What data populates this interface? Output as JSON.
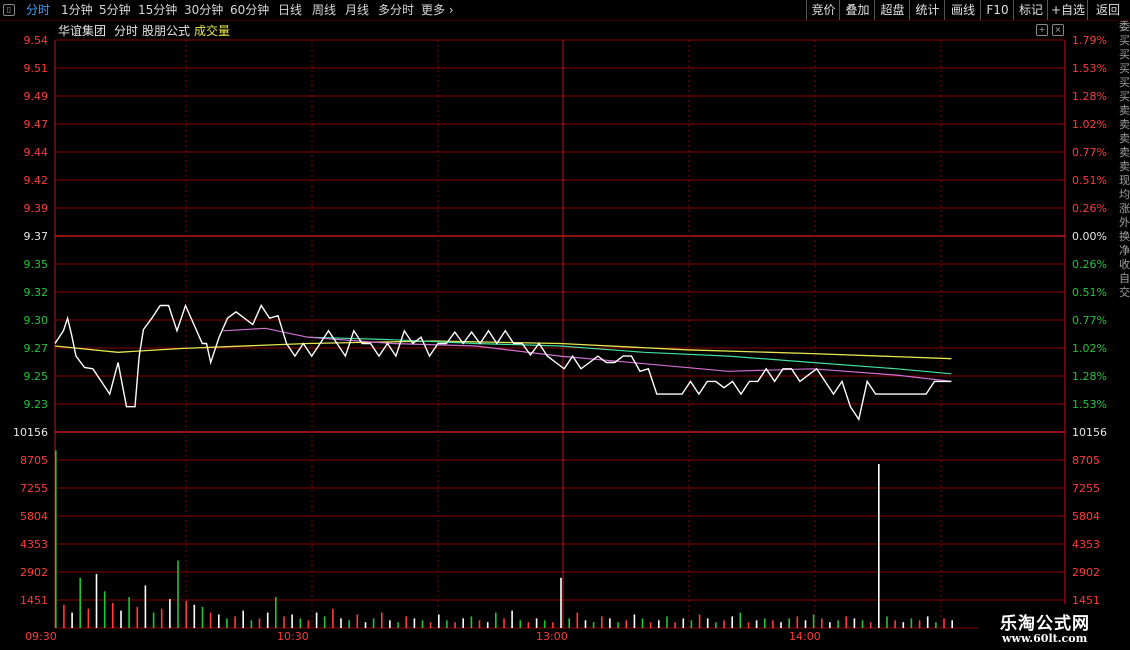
{
  "toolbar": {
    "left_tabs": [
      "分时",
      "1分钟",
      "5分钟",
      "15分钟",
      "30分钟",
      "60分钟",
      "日线",
      "周线",
      "月线",
      "多分时",
      "更多"
    ],
    "active_tab": "分时",
    "right_buttons": [
      "竞价",
      "叠加",
      "超盘",
      "统计",
      "画线",
      "F10",
      "标记",
      "+自选",
      "返回"
    ]
  },
  "header": {
    "stock_name": "华谊集团",
    "mode": "分时",
    "formula": "股朋公式",
    "volume_label": "成交量"
  },
  "price_axis": {
    "labels": [
      "9.54",
      "9.51",
      "9.49",
      "9.47",
      "9.44",
      "9.42",
      "9.39",
      "9.37",
      "9.35",
      "9.32",
      "9.30",
      "9.27",
      "9.25",
      "9.23"
    ],
    "pct_labels": [
      "1.79%",
      "1.53%",
      "1.28%",
      "1.02%",
      "0.77%",
      "0.51%",
      "0.26%",
      "0.00%",
      "0.26%",
      "0.51%",
      "0.77%",
      "1.02%",
      "1.28%",
      "1.53%"
    ],
    "prev_close": "9.37"
  },
  "volume_axis": {
    "labels": [
      "10156",
      "8705",
      "7255",
      "5804",
      "4353",
      "2902",
      "1451"
    ]
  },
  "time_axis": {
    "labels": [
      "09:30",
      "10:30",
      "13:00",
      "14:00"
    ]
  },
  "chart_data": {
    "type": "line",
    "x_unit": "minutes since 09:30 (0-240)",
    "price_series": {
      "name": "price",
      "x": [
        0,
        2,
        3,
        4,
        5,
        7,
        9,
        11,
        13,
        15,
        17,
        19,
        20,
        21,
        23,
        25,
        27,
        29,
        31,
        33,
        35,
        36,
        37,
        39,
        41,
        43,
        45,
        47,
        49,
        51,
        53,
        55,
        57,
        59,
        61,
        63,
        65,
        67,
        69,
        71,
        73,
        75,
        77,
        79,
        81,
        83,
        85,
        87,
        89,
        91,
        93,
        95,
        97,
        99,
        101,
        103,
        105,
        107,
        109,
        111,
        113,
        115,
        117,
        119,
        121,
        123,
        125,
        127,
        129,
        131,
        133,
        135,
        137,
        139,
        141,
        143,
        145,
        147,
        149,
        151,
        153,
        155,
        157,
        159,
        161,
        163,
        165,
        167,
        169,
        171,
        173,
        175,
        177,
        179,
        181,
        183,
        185,
        187,
        189,
        191,
        193,
        195,
        197,
        199,
        201,
        203,
        205,
        207,
        209,
        211,
        213
      ],
      "values": [
        9.3,
        9.31,
        9.32,
        9.306,
        9.29,
        9.281,
        9.28,
        9.27,
        9.26,
        9.285,
        9.25,
        9.25,
        9.29,
        9.311,
        9.32,
        9.33,
        9.33,
        9.31,
        9.33,
        9.315,
        9.3,
        9.3,
        9.285,
        9.305,
        9.32,
        9.325,
        9.32,
        9.315,
        9.33,
        9.32,
        9.322,
        9.3,
        9.29,
        9.3,
        9.29,
        9.3,
        9.31,
        9.3,
        9.29,
        9.31,
        9.3,
        9.3,
        9.29,
        9.3,
        9.29,
        9.31,
        9.3,
        9.305,
        9.29,
        9.3,
        9.3,
        9.309,
        9.3,
        9.309,
        9.3,
        9.31,
        9.3,
        9.31,
        9.3,
        9.3,
        9.291,
        9.3,
        9.29,
        9.285,
        9.28,
        9.29,
        9.28,
        9.285,
        9.29,
        9.285,
        9.285,
        9.29,
        9.29,
        9.278,
        9.28,
        9.26,
        9.26,
        9.26,
        9.26,
        9.27,
        9.26,
        9.27,
        9.27,
        9.265,
        9.27,
        9.26,
        9.27,
        9.27,
        9.28,
        9.27,
        9.28,
        9.28,
        9.27,
        9.275,
        9.28,
        9.27,
        9.26,
        9.27,
        9.25,
        9.24,
        9.27,
        9.26,
        9.26,
        9.26,
        9.26,
        9.26,
        9.26,
        9.26,
        9.27,
        9.27,
        9.27
      ]
    },
    "avg_series": {
      "name": "均价",
      "x": [
        0,
        15,
        30,
        60,
        90,
        120,
        150,
        180,
        213
      ],
      "values": [
        9.298,
        9.293,
        9.296,
        9.3,
        9.302,
        9.3,
        9.295,
        9.292,
        9.288
      ]
    },
    "ma1_series": {
      "name": "ma1",
      "x": [
        40,
        50,
        60,
        80,
        100,
        120,
        140,
        160,
        180,
        200,
        213
      ],
      "values": [
        9.31,
        9.312,
        9.305,
        9.3,
        9.298,
        9.29,
        9.284,
        9.278,
        9.28,
        9.275,
        9.27
      ]
    },
    "ma2_series": {
      "name": "ma2",
      "x": [
        60,
        80,
        100,
        120,
        140,
        160,
        180,
        200,
        213
      ],
      "values": [
        9.305,
        9.303,
        9.3,
        9.298,
        9.293,
        9.29,
        9.285,
        9.28,
        9.276
      ]
    },
    "volumes": [
      9200,
      1200,
      800,
      2600,
      1000,
      2800,
      1900,
      1300,
      900,
      1600,
      1100,
      2200,
      800,
      1000,
      1500,
      3500,
      1400,
      1200,
      1100,
      800,
      700,
      500,
      600,
      900,
      400,
      500,
      800,
      1600,
      600,
      700,
      500,
      400,
      800,
      600,
      1000,
      500,
      400,
      700,
      300,
      500,
      800,
      400,
      300,
      600,
      500,
      400,
      300,
      700,
      400,
      300,
      500,
      600,
      400,
      300,
      800,
      500,
      900,
      400,
      300,
      500,
      400,
      300,
      2600,
      500,
      800,
      400,
      300,
      600,
      500,
      300,
      400,
      700,
      500,
      300,
      400,
      600,
      300,
      500,
      400,
      700,
      500,
      300,
      400,
      600,
      800,
      300,
      400,
      500,
      400,
      300,
      500,
      600,
      400,
      700,
      500,
      300,
      400,
      600,
      500,
      400,
      300,
      8500,
      600,
      400,
      300,
      500,
      400,
      600,
      300,
      500,
      400
    ],
    "ylim": [
      9.23,
      9.54
    ],
    "volume_max": 10156
  },
  "watermark": {
    "title": "乐淘公式网",
    "url": "www.60lt.com"
  },
  "side_strip": [
    "委",
    "买",
    "买",
    "买",
    "买",
    "买",
    "卖",
    "卖",
    "卖",
    "卖",
    "卖",
    "现",
    "均",
    "涨",
    "外",
    "换",
    "净",
    "收",
    "自",
    "交"
  ],
  "colors": {
    "grid": "#8a0000",
    "up": "#ff3b3b",
    "down": "#22c43a",
    "price_line": "#ffffff",
    "avg_line": "#e6e650",
    "ma1_line": "#d070d0",
    "ma2_line": "#40e0a0"
  }
}
